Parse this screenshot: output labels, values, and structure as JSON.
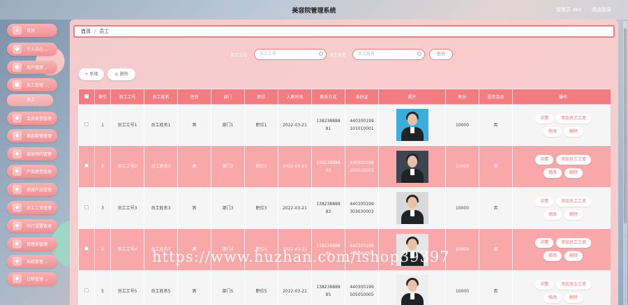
{
  "header": {
    "title": "美容院管理系统",
    "user": "管理员 abo",
    "logout": "退出登录"
  },
  "sidebar": {
    "items": [
      {
        "label": "首页",
        "icon": "home-icon"
      },
      {
        "label": "个人中心 ⌄",
        "icon": "user-icon"
      },
      {
        "label": "用户管理 ⌄",
        "icon": "users-icon"
      },
      {
        "label": "员工管理 ⌄",
        "icon": "staff-icon"
      },
      {
        "label": "会员类型管理",
        "icon": "member-type-icon"
      },
      {
        "label": "美容套餐管理",
        "icon": "package-icon"
      },
      {
        "label": "美容预约管理",
        "icon": "appointment-icon"
      },
      {
        "label": "产品类型管理",
        "icon": "product-type-icon"
      },
      {
        "label": "美容产品管理",
        "icon": "product-icon"
      },
      {
        "label": "员工工资管理",
        "icon": "salary-icon"
      },
      {
        "label": "失行设置管理",
        "icon": "settings-icon"
      },
      {
        "label": "管理员管理",
        "icon": "admin-icon"
      },
      {
        "label": "系统管理 ⌄",
        "icon": "system-icon"
      },
      {
        "label": "订单管理 ⌄",
        "icon": "order-icon"
      }
    ],
    "sub_item": "员工"
  },
  "breadcrumb": {
    "home": "首页",
    "separator": "/",
    "current": "员工"
  },
  "search": {
    "label1": "员工工号",
    "placeholder1": "员工工号",
    "label2": "员工姓名",
    "placeholder2": "员工姓名",
    "button": "查询"
  },
  "toolbar": {
    "add": "+ 新增",
    "delete": "◎ 删除"
  },
  "table": {
    "headers": [
      "索引",
      "员工工号",
      "员工姓名",
      "性别",
      "部门",
      "职位",
      "入职时间",
      "联系方式",
      "身份证",
      "照片",
      "积分",
      "是否会员",
      "操作"
    ],
    "rows": [
      {
        "index": "1",
        "no": "员工工号1",
        "name": "员工姓名1",
        "gender": "男",
        "dept": "部门1",
        "position": "职位1",
        "date": "2022-03-21",
        "phone1": "138238888",
        "phone2": "81",
        "id1": "440300199",
        "id2": "101010001",
        "points": "10000",
        "member": "否"
      },
      {
        "index": "2",
        "no": "员工工号2",
        "name": "员工姓名2",
        "gender": "男",
        "dept": "部门2",
        "position": "职位2",
        "date": "2022-03-21",
        "phone1": "138238888",
        "phone2": "82",
        "id1": "440300199",
        "id2": "202020002",
        "points": "10000",
        "member": "否"
      },
      {
        "index": "3",
        "no": "员工工号3",
        "name": "员工姓名3",
        "gender": "男",
        "dept": "部门3",
        "position": "职位3",
        "date": "2022-03-21",
        "phone1": "138238888",
        "phone2": "83",
        "id1": "440300199",
        "id2": "303030003",
        "points": "10000",
        "member": "否"
      },
      {
        "index": "4",
        "no": "员工工号4",
        "name": "员工姓名4",
        "gender": "男",
        "dept": "部门4",
        "position": "职位4",
        "date": "2022-03-21",
        "phone1": "138238888",
        "phone2": "84",
        "id1": "440300199",
        "id2": "404040004",
        "points": "10000",
        "member": "否"
      },
      {
        "index": "5",
        "no": "员工工号5",
        "name": "员工姓名5",
        "gender": "男",
        "dept": "部门5",
        "position": "职位5",
        "date": "2022-03-21",
        "phone1": "138238888",
        "phone2": "85",
        "id1": "440300199",
        "id2": "505050005",
        "points": "10000",
        "member": "否"
      }
    ],
    "ops": {
      "detail": "详情",
      "add_salary": "添加员工工资",
      "edit": "修改",
      "delete": "删除"
    }
  },
  "watermark": "https://www.huzhan.com/ishop39397",
  "colors": {
    "accent": "#f17d83",
    "row_pink": "#f9a8aa",
    "panel": "#fccdcd"
  }
}
